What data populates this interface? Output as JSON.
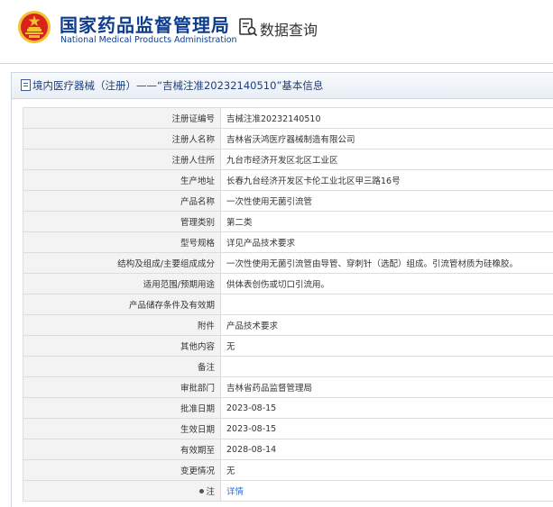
{
  "header": {
    "brand_cn": "国家药品监督管理局",
    "brand_en": "National Medical Products Administration",
    "query_title": "数据查询",
    "colors": {
      "brand": "#0f3d8c",
      "emblem_red": "#d8231c",
      "emblem_gold": "#f2c230"
    }
  },
  "panel": {
    "title": "境内医疗器械（注册）——“吉械注准20232140510”基本信息"
  },
  "rows": [
    {
      "label": "注册证编号",
      "value": "吉械注准20232140510"
    },
    {
      "label": "注册人名称",
      "value": "吉林省沃鸿医疗器械制造有限公司"
    },
    {
      "label": "注册人住所",
      "value": "九台市经济开发区北区工业区"
    },
    {
      "label": "生产地址",
      "value": "长春九台经济开发区卡伦工业北区甲三路16号"
    },
    {
      "label": "产品名称",
      "value": "一次性使用无菌引流管"
    },
    {
      "label": "管理类别",
      "value": "第二类"
    },
    {
      "label": "型号规格",
      "value": "详见产品技术要求"
    },
    {
      "label": "结构及组成/主要组成成分",
      "value": "一次性使用无菌引流管由导管、穿刺针（选配）组成。引流管材质为硅橡胶。"
    },
    {
      "label": "适用范围/预期用途",
      "value": "供体表创伤或切口引流用。"
    },
    {
      "label": "产品储存条件及有效期",
      "value": ""
    },
    {
      "label": "附件",
      "value": "产品技术要求"
    },
    {
      "label": "其他内容",
      "value": "无"
    },
    {
      "label": "备注",
      "value": ""
    },
    {
      "label": "审批部门",
      "value": "吉林省药品监督管理局"
    },
    {
      "label": "批准日期",
      "value": "2023-08-15"
    },
    {
      "label": "生效日期",
      "value": "2023-08-15"
    },
    {
      "label": "有效期至",
      "value": "2028-08-14"
    },
    {
      "label": "变更情况",
      "value": "无"
    },
    {
      "label": "注",
      "value": "详情",
      "link": true
    }
  ]
}
